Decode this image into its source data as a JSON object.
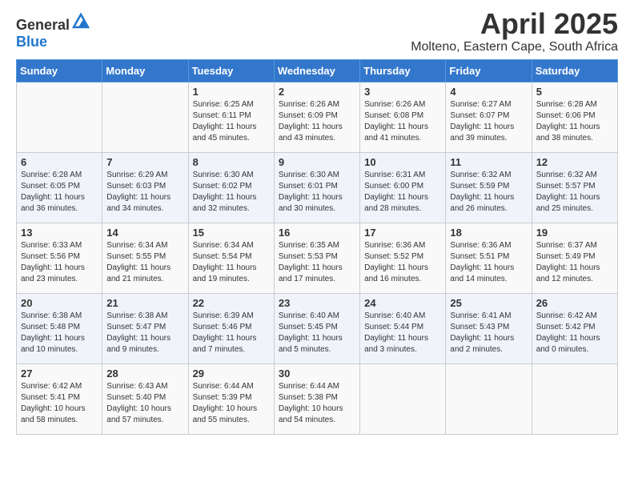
{
  "header": {
    "logo_general": "General",
    "logo_blue": "Blue",
    "title": "April 2025",
    "subtitle": "Molteno, Eastern Cape, South Africa"
  },
  "days_of_week": [
    "Sunday",
    "Monday",
    "Tuesday",
    "Wednesday",
    "Thursday",
    "Friday",
    "Saturday"
  ],
  "weeks": [
    {
      "cells": [
        {
          "day": "",
          "info": ""
        },
        {
          "day": "",
          "info": ""
        },
        {
          "day": "1",
          "info": "Sunrise: 6:25 AM\nSunset: 6:11 PM\nDaylight: 11 hours and 45 minutes."
        },
        {
          "day": "2",
          "info": "Sunrise: 6:26 AM\nSunset: 6:09 PM\nDaylight: 11 hours and 43 minutes."
        },
        {
          "day": "3",
          "info": "Sunrise: 6:26 AM\nSunset: 6:08 PM\nDaylight: 11 hours and 41 minutes."
        },
        {
          "day": "4",
          "info": "Sunrise: 6:27 AM\nSunset: 6:07 PM\nDaylight: 11 hours and 39 minutes."
        },
        {
          "day": "5",
          "info": "Sunrise: 6:28 AM\nSunset: 6:06 PM\nDaylight: 11 hours and 38 minutes."
        }
      ]
    },
    {
      "cells": [
        {
          "day": "6",
          "info": "Sunrise: 6:28 AM\nSunset: 6:05 PM\nDaylight: 11 hours and 36 minutes."
        },
        {
          "day": "7",
          "info": "Sunrise: 6:29 AM\nSunset: 6:03 PM\nDaylight: 11 hours and 34 minutes."
        },
        {
          "day": "8",
          "info": "Sunrise: 6:30 AM\nSunset: 6:02 PM\nDaylight: 11 hours and 32 minutes."
        },
        {
          "day": "9",
          "info": "Sunrise: 6:30 AM\nSunset: 6:01 PM\nDaylight: 11 hours and 30 minutes."
        },
        {
          "day": "10",
          "info": "Sunrise: 6:31 AM\nSunset: 6:00 PM\nDaylight: 11 hours and 28 minutes."
        },
        {
          "day": "11",
          "info": "Sunrise: 6:32 AM\nSunset: 5:59 PM\nDaylight: 11 hours and 26 minutes."
        },
        {
          "day": "12",
          "info": "Sunrise: 6:32 AM\nSunset: 5:57 PM\nDaylight: 11 hours and 25 minutes."
        }
      ]
    },
    {
      "cells": [
        {
          "day": "13",
          "info": "Sunrise: 6:33 AM\nSunset: 5:56 PM\nDaylight: 11 hours and 23 minutes."
        },
        {
          "day": "14",
          "info": "Sunrise: 6:34 AM\nSunset: 5:55 PM\nDaylight: 11 hours and 21 minutes."
        },
        {
          "day": "15",
          "info": "Sunrise: 6:34 AM\nSunset: 5:54 PM\nDaylight: 11 hours and 19 minutes."
        },
        {
          "day": "16",
          "info": "Sunrise: 6:35 AM\nSunset: 5:53 PM\nDaylight: 11 hours and 17 minutes."
        },
        {
          "day": "17",
          "info": "Sunrise: 6:36 AM\nSunset: 5:52 PM\nDaylight: 11 hours and 16 minutes."
        },
        {
          "day": "18",
          "info": "Sunrise: 6:36 AM\nSunset: 5:51 PM\nDaylight: 11 hours and 14 minutes."
        },
        {
          "day": "19",
          "info": "Sunrise: 6:37 AM\nSunset: 5:49 PM\nDaylight: 11 hours and 12 minutes."
        }
      ]
    },
    {
      "cells": [
        {
          "day": "20",
          "info": "Sunrise: 6:38 AM\nSunset: 5:48 PM\nDaylight: 11 hours and 10 minutes."
        },
        {
          "day": "21",
          "info": "Sunrise: 6:38 AM\nSunset: 5:47 PM\nDaylight: 11 hours and 9 minutes."
        },
        {
          "day": "22",
          "info": "Sunrise: 6:39 AM\nSunset: 5:46 PM\nDaylight: 11 hours and 7 minutes."
        },
        {
          "day": "23",
          "info": "Sunrise: 6:40 AM\nSunset: 5:45 PM\nDaylight: 11 hours and 5 minutes."
        },
        {
          "day": "24",
          "info": "Sunrise: 6:40 AM\nSunset: 5:44 PM\nDaylight: 11 hours and 3 minutes."
        },
        {
          "day": "25",
          "info": "Sunrise: 6:41 AM\nSunset: 5:43 PM\nDaylight: 11 hours and 2 minutes."
        },
        {
          "day": "26",
          "info": "Sunrise: 6:42 AM\nSunset: 5:42 PM\nDaylight: 11 hours and 0 minutes."
        }
      ]
    },
    {
      "cells": [
        {
          "day": "27",
          "info": "Sunrise: 6:42 AM\nSunset: 5:41 PM\nDaylight: 10 hours and 58 minutes."
        },
        {
          "day": "28",
          "info": "Sunrise: 6:43 AM\nSunset: 5:40 PM\nDaylight: 10 hours and 57 minutes."
        },
        {
          "day": "29",
          "info": "Sunrise: 6:44 AM\nSunset: 5:39 PM\nDaylight: 10 hours and 55 minutes."
        },
        {
          "day": "30",
          "info": "Sunrise: 6:44 AM\nSunset: 5:38 PM\nDaylight: 10 hours and 54 minutes."
        },
        {
          "day": "",
          "info": ""
        },
        {
          "day": "",
          "info": ""
        },
        {
          "day": "",
          "info": ""
        }
      ]
    }
  ]
}
